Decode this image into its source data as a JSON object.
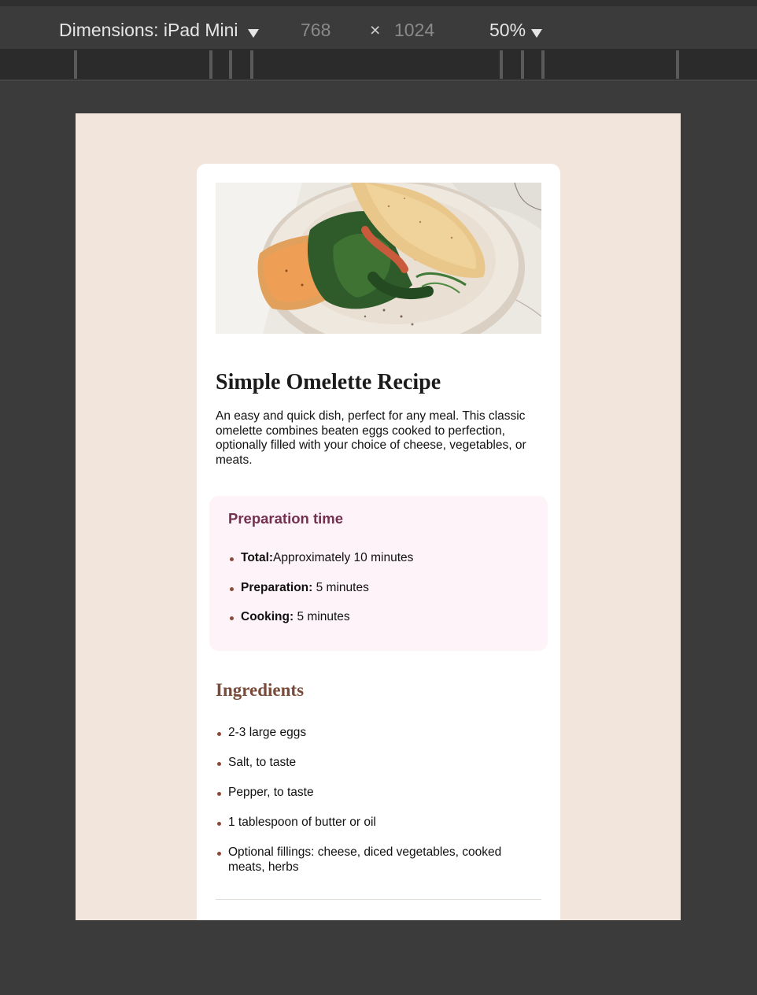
{
  "devtools": {
    "dimensions_label": "Dimensions: iPad Mini",
    "width": "768",
    "times_symbol": "×",
    "height": "1024",
    "zoom": "50%"
  },
  "recipe": {
    "image_alt": "Omelette on a plate with spinach and toast",
    "title": "Simple Omelette Recipe",
    "description": "An easy and quick dish, perfect for any meal. This classic omelette combines beaten eggs cooked to perfection, optionally filled with your choice of cheese, vegetables, or meats.",
    "preparation": {
      "heading": "Preparation time",
      "items": [
        {
          "label": "Total:",
          "value": "Approximately 10 minutes"
        },
        {
          "label": "Preparation:",
          "value": " 5 minutes"
        },
        {
          "label": "Cooking:",
          "value": " 5 minutes"
        }
      ]
    },
    "ingredients": {
      "heading": "Ingredients",
      "items": [
        "2-3 large eggs",
        "Salt, to taste",
        "Pepper, to taste",
        "1 tablespoon of butter or oil",
        "Optional fillings: cheese, diced vegetables, cooked meats, herbs"
      ]
    }
  },
  "colors": {
    "page_bg": "#f2e6dc",
    "card_bg": "#ffffff",
    "prep_bg": "#fdf3f8",
    "prep_heading": "#73304f",
    "ingredients_heading": "#7a4b3a",
    "bullet": "#8a4a3a"
  }
}
